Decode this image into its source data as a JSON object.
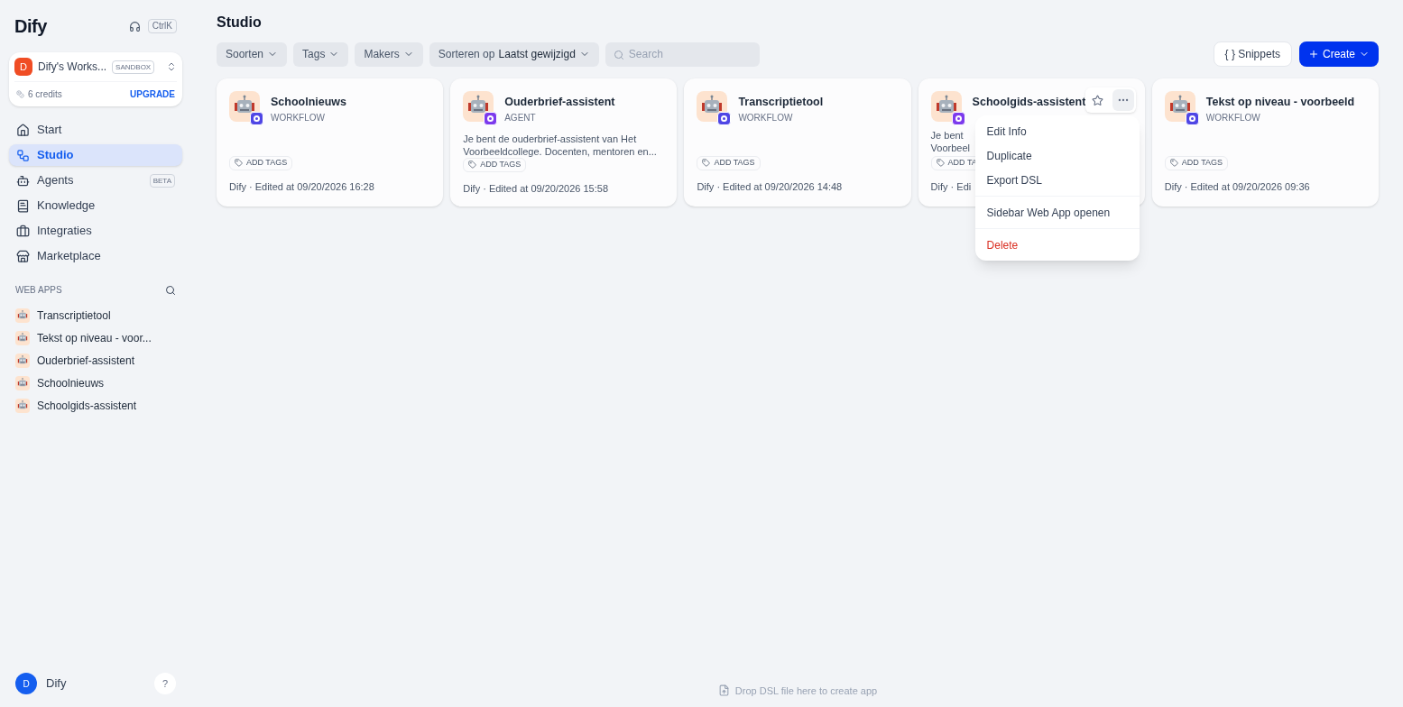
{
  "logo": "Dify",
  "shortcut": "CtrlK",
  "workspace": {
    "initial": "D",
    "name": "Dify's Works...",
    "plan": "SANDBOX",
    "credits": "6 credits",
    "upgrade": "UPGRADE"
  },
  "nav": [
    {
      "kind": "home",
      "label": "Start",
      "selected": false
    },
    {
      "kind": "studio",
      "label": "Studio",
      "selected": true
    },
    {
      "kind": "agents",
      "label": "Agents",
      "selected": false,
      "badge": "BETA"
    },
    {
      "kind": "knowledge",
      "label": "Knowledge",
      "selected": false
    },
    {
      "kind": "integrations",
      "label": "Integraties",
      "selected": false
    },
    {
      "kind": "marketplace",
      "label": "Marketplace",
      "selected": false
    }
  ],
  "web_apps": {
    "title": "WEB APPS",
    "items": [
      "Transcriptietool",
      "Tekst op niveau - voor...",
      "Ouderbrief-assistent",
      "Schoolnieuws",
      "Schoolgids-assistent"
    ]
  },
  "user": {
    "initial": "D",
    "name": "Dify",
    "help": "?"
  },
  "page_title": "Studio",
  "filters": [
    {
      "label": "Soorten"
    },
    {
      "label": "Tags"
    },
    {
      "label": "Makers"
    },
    {
      "label": "Sorteren op",
      "value": "Laatst gewijzigd"
    }
  ],
  "search": {
    "placeholder": "Search"
  },
  "snippets_button": "{ } Snippets",
  "create_button": "Create",
  "apps": [
    {
      "name": "Schoolnieuws",
      "type": "WORKFLOW",
      "kind": "workflow",
      "add_tags": "ADD TAGS",
      "meta": "Dify · Edited at 09/20/2026 16:28"
    },
    {
      "name": "Ouderbrief-assistent",
      "type": "AGENT",
      "kind": "agent",
      "description": [
        "Je bent de ouderbrief-assistent van Het",
        "Voorbeeldcollege. Docenten, mentoren en..."
      ],
      "add_tags": "ADD TAGS",
      "meta": "Dify · Edited at 09/20/2026 15:58"
    },
    {
      "name": "Transcriptietool",
      "type": "WORKFLOW",
      "kind": "workflow",
      "add_tags": "ADD TAGS",
      "meta": "Dify · Edited at 09/20/2026 14:48"
    },
    {
      "name": "Schoolgids-assistent",
      "kind": "agent",
      "description": [
        "Je bent",
        "Voorbeel"
      ],
      "add_tags": "ADD TA",
      "meta": "Dify · Edi",
      "hovered": true
    },
    {
      "name": "Tekst op niveau - voorbeeld",
      "type": "WORKFLOW",
      "kind": "workflow",
      "add_tags": "ADD TAGS",
      "meta": "Dify · Edited at 09/20/2026 09:36"
    }
  ],
  "context_menu": {
    "items": [
      {
        "label": "Edit Info",
        "kind": "normal"
      },
      {
        "label": "Duplicate",
        "kind": "normal"
      },
      {
        "label": "Export DSL",
        "kind": "normal"
      },
      {
        "label": "Sidebar Web App openen",
        "kind": "normal"
      },
      {
        "label": "Delete",
        "kind": "danger"
      }
    ]
  },
  "drop_hint": "Drop DSL file here to create app"
}
